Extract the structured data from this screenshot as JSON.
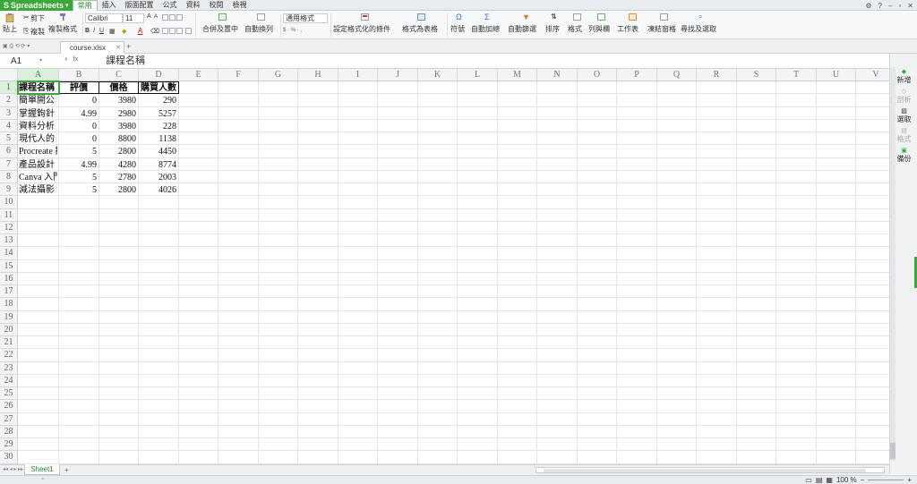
{
  "app": {
    "name": "Spreadsheets"
  },
  "menu": {
    "tabs": [
      "常用",
      "插入",
      "版面配置",
      "公式",
      "資料",
      "校閱",
      "檢視"
    ],
    "active": "常用"
  },
  "ribbon": {
    "paste": "貼上",
    "cut": "剪下",
    "copy": "複製",
    "format_painter": "複製格式",
    "font_name": "Calibri",
    "font_size": "11",
    "merge_center": "合併及置中",
    "wrap_text": "自動換列",
    "number_format": "通用格式",
    "conditional_format": "設定格式化的條件",
    "format_as_table": "格式為表格",
    "symbol": "符號",
    "autosum": "自動加總",
    "autofilter": "自動篩選",
    "sort": "排序",
    "format": "格式",
    "rows_cols": "列與欄",
    "worksheet": "工作表",
    "freeze_panes": "凍結窗格",
    "find_select": "尋找及選取"
  },
  "document": {
    "tab_name": "course.xlsx"
  },
  "formula_bar": {
    "name_box": "A1",
    "content": "課程名稱"
  },
  "grid": {
    "columns": [
      "A",
      "B",
      "C",
      "D",
      "E",
      "F",
      "G",
      "H",
      "I",
      "J",
      "K",
      "L",
      "M",
      "N",
      "O",
      "P",
      "Q",
      "R",
      "S",
      "T",
      "U",
      "V"
    ],
    "row_count": 30,
    "headers": [
      "課程名稱",
      "評價",
      "價格",
      "購買人數"
    ],
    "rows": [
      [
        "簡單開公",
        "0",
        "3980",
        "290"
      ],
      [
        "掌握鉤針",
        "4.99",
        "2980",
        "5257"
      ],
      [
        "資料分析",
        "0",
        "3980",
        "228"
      ],
      [
        "現代人的",
        "0",
        "8800",
        "1138"
      ],
      [
        "Procreate 插",
        "5",
        "2800",
        "4450"
      ],
      [
        "產品設計",
        "4.99",
        "4280",
        "8774"
      ],
      [
        "Canva 入門",
        "5",
        "2780",
        "2003"
      ],
      [
        "減法攝影",
        "5",
        "2800",
        "4026"
      ]
    ]
  },
  "right_panel": {
    "items": [
      "新增",
      "剖析",
      "選取",
      "格式",
      "備份"
    ]
  },
  "sheets": {
    "tabs": [
      "Sheet1"
    ]
  },
  "status": {
    "zoom": "100 %"
  }
}
